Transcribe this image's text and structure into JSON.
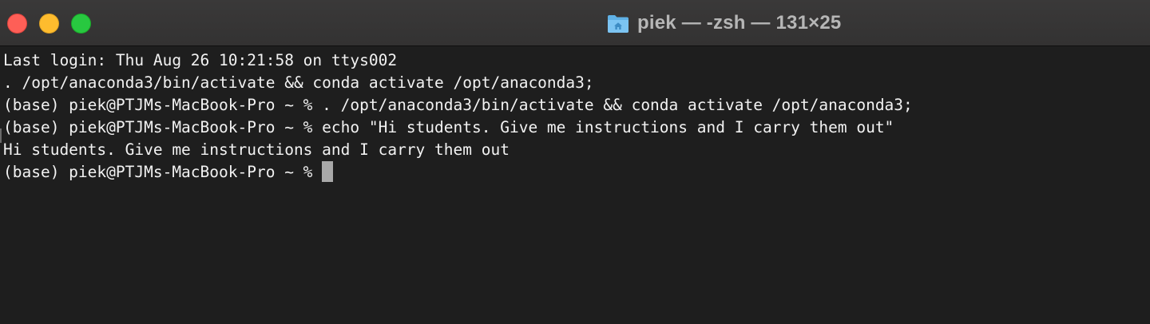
{
  "window": {
    "title": "piek — -zsh — 131×25",
    "title_icon": "home-folder-icon",
    "traffic_lights": {
      "close_color": "#fe5f57",
      "minimize_color": "#febc2e",
      "zoom_color": "#28c840"
    }
  },
  "terminal": {
    "background_color": "#1e1e1e",
    "text_color": "#f2f2f2",
    "lines": [
      "Last login: Thu Aug 26 10:21:58 on ttys002",
      ". /opt/anaconda3/bin/activate && conda activate /opt/anaconda3;",
      "(base) piek@PTJMs-MacBook-Pro ~ % . /opt/anaconda3/bin/activate && conda activate /opt/anaconda3;",
      "(base) piek@PTJMs-MacBook-Pro ~ % echo \"Hi students. Give me instructions and I carry them out\"",
      "Hi students. Give me instructions and I carry them out"
    ],
    "current_prompt": "(base) piek@PTJMs-MacBook-Pro ~ % "
  }
}
